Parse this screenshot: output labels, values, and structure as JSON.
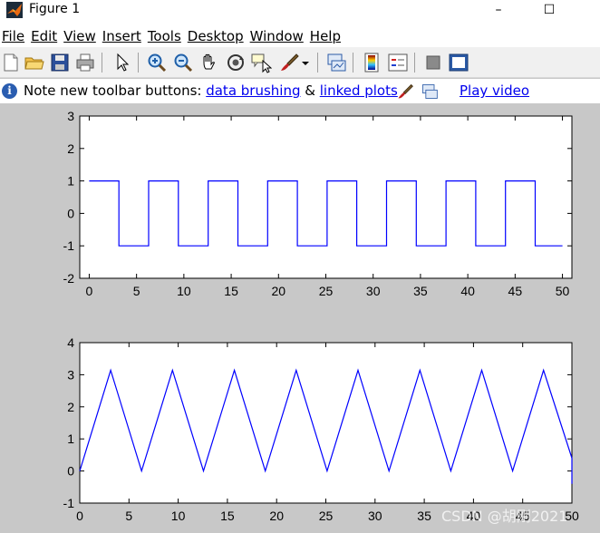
{
  "window": {
    "title": "Figure 1",
    "controls": {
      "minimize": "–",
      "maximize": "☐"
    }
  },
  "menu": [
    "File",
    "Edit",
    "View",
    "Insert",
    "Tools",
    "Desktop",
    "Window",
    "Help"
  ],
  "toolbar": {
    "buttons": [
      {
        "name": "new-figure-icon"
      },
      {
        "name": "open-file-icon"
      },
      {
        "name": "save-icon"
      },
      {
        "name": "print-icon"
      },
      {
        "name": "edit-plot-arrow-icon"
      },
      {
        "name": "zoom-in-icon"
      },
      {
        "name": "zoom-out-icon"
      },
      {
        "name": "pan-hand-icon"
      },
      {
        "name": "rotate-3d-icon"
      },
      {
        "name": "data-cursor-icon"
      },
      {
        "name": "data-brushing-icon"
      },
      {
        "name": "dropdown-arrow-icon"
      },
      {
        "name": "link-plot-icon"
      },
      {
        "name": "colorbar-icon"
      },
      {
        "name": "legend-icon"
      },
      {
        "name": "hide-plot-tools-icon"
      },
      {
        "name": "show-plot-tools-icon"
      }
    ]
  },
  "infobar": {
    "text": "Note new toolbar buttons: ",
    "link1": "data brushing",
    "amp": " & ",
    "link2": "linked plots",
    "video": "Play video"
  },
  "colors": {
    "line": "#0000ff",
    "axes_bg": "#ffffff",
    "figure_bg": "#c8c8c8",
    "link": "#0000ee"
  },
  "chart_data": [
    {
      "type": "line",
      "series": [
        {
          "x": [
            0,
            3.14,
            3.14,
            6.28,
            6.28,
            9.42,
            9.42,
            12.57,
            12.57,
            15.71,
            15.71,
            18.85,
            18.85,
            21.99,
            21.99,
            25.13,
            25.13,
            28.27,
            28.27,
            31.42,
            31.42,
            34.56,
            34.56,
            37.7,
            37.7,
            40.84,
            40.84,
            43.98,
            43.98,
            47.12,
            47.12,
            50
          ],
          "y": [
            1,
            1,
            -1,
            -1,
            1,
            1,
            -1,
            -1,
            1,
            1,
            -1,
            -1,
            1,
            1,
            -1,
            -1,
            1,
            1,
            -1,
            -1,
            1,
            1,
            -1,
            -1,
            1,
            1,
            -1,
            -1,
            1,
            1,
            -1,
            -1
          ]
        }
      ],
      "xlim": [
        -1,
        51
      ],
      "ylim": [
        -2,
        3
      ],
      "xticks": [
        "0",
        "5",
        "10",
        "15",
        "20",
        "25",
        "30",
        "35",
        "40",
        "45",
        "50"
      ],
      "yticks": [
        "-2",
        "-1",
        "0",
        "1",
        "2",
        "3"
      ],
      "grid": false
    },
    {
      "type": "line",
      "series": [
        {
          "x": [
            0,
            3.14,
            6.28,
            9.42,
            12.57,
            15.71,
            18.85,
            21.99,
            25.13,
            28.27,
            31.42,
            34.56,
            37.7,
            40.84,
            43.98,
            47.12,
            50,
            50
          ],
          "y": [
            0,
            3.14,
            0,
            3.14,
            0,
            3.14,
            0,
            3.14,
            0,
            3.14,
            0,
            3.14,
            0,
            3.14,
            0,
            3.14,
            0.4,
            -0.4
          ]
        }
      ],
      "xlim": [
        0,
        50
      ],
      "ylim": [
        -1,
        4
      ],
      "xticks": [
        "0",
        "5",
        "10",
        "15",
        "20",
        "25",
        "30",
        "35",
        "40",
        "45",
        "50"
      ],
      "yticks": [
        "-1",
        "0",
        "1",
        "2",
        "3",
        "4"
      ],
      "grid": false
    }
  ],
  "watermark": "CSDN @胡刚2021"
}
